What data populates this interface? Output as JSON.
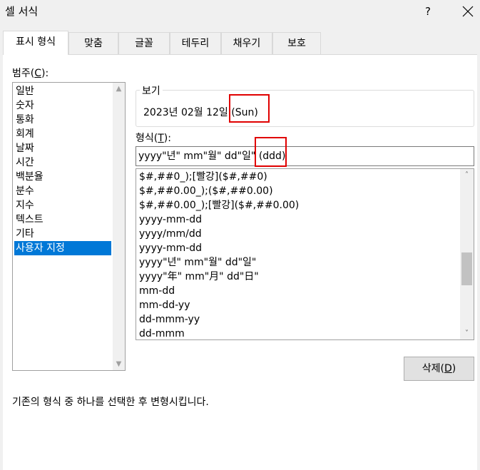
{
  "window": {
    "title": "셀 서식",
    "help_label": "?"
  },
  "tabs": [
    {
      "label": "표시 형식",
      "active": true
    },
    {
      "label": "맞춤"
    },
    {
      "label": "글꼴"
    },
    {
      "label": "테두리"
    },
    {
      "label": "채우기"
    },
    {
      "label": "보호"
    }
  ],
  "category": {
    "label_prefix": "범주(",
    "label_key": "C",
    "label_suffix": "):",
    "items": [
      "일반",
      "숫자",
      "통화",
      "회계",
      "날짜",
      "시간",
      "백분율",
      "분수",
      "지수",
      "텍스트",
      "기타",
      "사용자 지정"
    ],
    "selected": "사용자 지정"
  },
  "sample": {
    "label": "보기",
    "value": "2023년 02월 12일 (Sun)"
  },
  "format": {
    "label_prefix": "형식(",
    "label_key": "T",
    "label_suffix": "):",
    "value": "yyyy\"년\" mm\"월\" dd\"일\" (ddd)",
    "list": [
      "$#,##0_);[빨강]($#,##0)",
      "$#,##0.00_);($#,##0.00)",
      "$#,##0.00_);[빨강]($#,##0.00)",
      "yyyy-mm-dd",
      "yyyy/mm/dd",
      "yyyy-mm-dd",
      "yyyy\"년\" mm\"월\" dd\"일\"",
      "yyyy\"年\" mm\"月\" dd\"日\"",
      "mm-dd",
      "mm-dd-yy",
      "dd-mmm-yy",
      "dd-mmm"
    ]
  },
  "buttons": {
    "delete_prefix": "삭제(",
    "delete_key": "D",
    "delete_suffix": ")"
  },
  "description": "기존의 형식 중 하나를 선택한 후 변형시킵니다.",
  "colors": {
    "selection": "#0078d7",
    "highlight": "#e00000"
  }
}
